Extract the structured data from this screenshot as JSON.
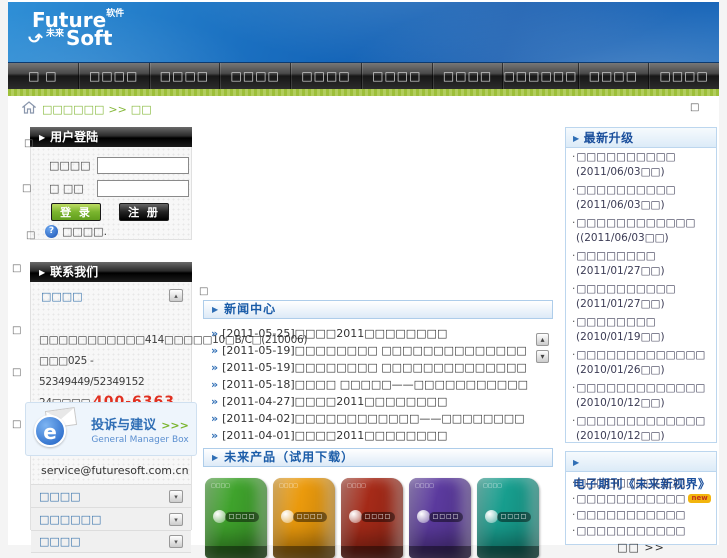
{
  "logo": {
    "line1": "Future",
    "line1_cn": "软件",
    "line2": "Soft",
    "line2_cn": "未来",
    "arrow": "↷"
  },
  "nav": {
    "items": [
      {
        "label": "□ □"
      },
      {
        "label": "□□□□"
      },
      {
        "label": "□□□□"
      },
      {
        "label": "□□□□"
      },
      {
        "label": "□□□□"
      },
      {
        "label": "□□□□"
      },
      {
        "label": "□□□□"
      },
      {
        "label": "□□□□□□"
      },
      {
        "label": "□□□□"
      },
      {
        "label": "□□□□"
      }
    ]
  },
  "breadcrumb": {
    "path": "□□□□□□",
    "sep": ">>",
    "current": "□□",
    "stray": "□"
  },
  "login": {
    "title": "用户登陆",
    "arrow": "▶",
    "username_label": "□□□□",
    "password_label": "□ □□",
    "login_btn": "登 录",
    "register_btn": "注 册",
    "help_q": "?",
    "forgot": "□□□□."
  },
  "contact": {
    "title": "联系我们",
    "arrow": "▶",
    "link": "□□□□",
    "collapse_up": "▴",
    "collapse_down": "▾",
    "address": "□□□□□□□□□□□414□□□□□10□B/C□(210006)　□□□025 - 52349449/52349152 24□□□□",
    "phone_red": "400-6363",
    "banner_title": "投诉与建议",
    "banner_arrows": ">>>",
    "banner_sub": "General Manager Box",
    "banner_e": "e",
    "email": "service@futuresoft.com.cn",
    "accordion": [
      {
        "label": "□□□□"
      },
      {
        "label": "□□□□□□"
      },
      {
        "label": "□□□□"
      }
    ]
  },
  "news": {
    "title": "新闻中心",
    "arrow": "▶",
    "bullet": "»",
    "scroll_up": "▴",
    "scroll_down": "▾",
    "items": [
      {
        "date": "[2011-05-25]",
        "title": "□□□□2011□□□□□□□□"
      },
      {
        "date": "[2011-05-19]",
        "title": "□□□□□□□□ □□□□□□□□□□□□□□"
      },
      {
        "date": "[2011-05-19]",
        "title": "□□□□□□□□ □□□□□□□□□□□□□□"
      },
      {
        "date": "[2011-05-18]",
        "title": "□□□□ □□□□□——□□□□□□□□□□□"
      },
      {
        "date": "[2011-04-27]",
        "title": "□□□□2011□□□□□□□□"
      },
      {
        "date": "[2011-04-02]",
        "title": "□□□□□□□□□□□□——□□□□□□□□"
      },
      {
        "date": "[2011-04-01]",
        "title": "□□□□2011□□□□□□□□"
      }
    ]
  },
  "products": {
    "title": "未来产品（试用下载）",
    "arrow": "▶",
    "brand": "□□□□",
    "items": [
      {
        "label": "□□□□",
        "color": "#3fa32c"
      },
      {
        "label": "□□□□",
        "color": "#eb9a0c"
      },
      {
        "label": "□□□□",
        "color": "#a52a18"
      },
      {
        "label": "□□□□",
        "color": "#5b3a9e"
      },
      {
        "label": "□□□□",
        "color": "#179e8e"
      }
    ]
  },
  "upgrades": {
    "title": "最新升级",
    "arrow": "▶",
    "items": [
      {
        "name": "□□□□□□□□□□",
        "date": "(2011/06/03□□)"
      },
      {
        "name": "□□□□□□□□□□",
        "date": "(2011/06/03□□)"
      },
      {
        "name": "□□□□□□□□□□□□",
        "date": "((2011/06/03□□)"
      },
      {
        "name": "□□□□□□□□",
        "date": "(2011/01/27□□)"
      },
      {
        "name": "□□□□□□□□□□",
        "date": "(2011/01/27□□)"
      },
      {
        "name": "□□□□□□□□",
        "date": "(2010/01/19□□)"
      },
      {
        "name": "□□□□□□□□□□□□□",
        "date": "(2010/01/26□□)"
      },
      {
        "name": "□□□□□□□□□□□□□",
        "date": "(2010/10/12□□)"
      },
      {
        "name": "□□□□□□□□□□□□□",
        "date": "(2010/10/12□□)"
      }
    ]
  },
  "journal": {
    "title": "电子期刊《未来新视界》",
    "arrow": "▶",
    "items": [
      {
        "name": "□□□□□□□□□□□",
        "badge": ""
      },
      {
        "name": "□□□□□□□□□□□",
        "badge": "new"
      },
      {
        "name": "□□□□□□□□□□□",
        "badge": ""
      },
      {
        "name": "□□□□□□□□□□□",
        "badge": ""
      }
    ],
    "more": "□□ >>"
  },
  "strays": {
    "char": "□"
  },
  "colors": {
    "banner_blue": "#0c55ac",
    "nav_dark": "#2c2c2c",
    "green_strip": "#9dbf3a",
    "breadcrumb_green": "#85b83a",
    "section_blue_text": "#1b5ca8",
    "login_btn_green": "#7ab52e",
    "phone_red": "#e03020",
    "new_badge": "#f2b50e",
    "link_blue": "#3a74ad"
  }
}
